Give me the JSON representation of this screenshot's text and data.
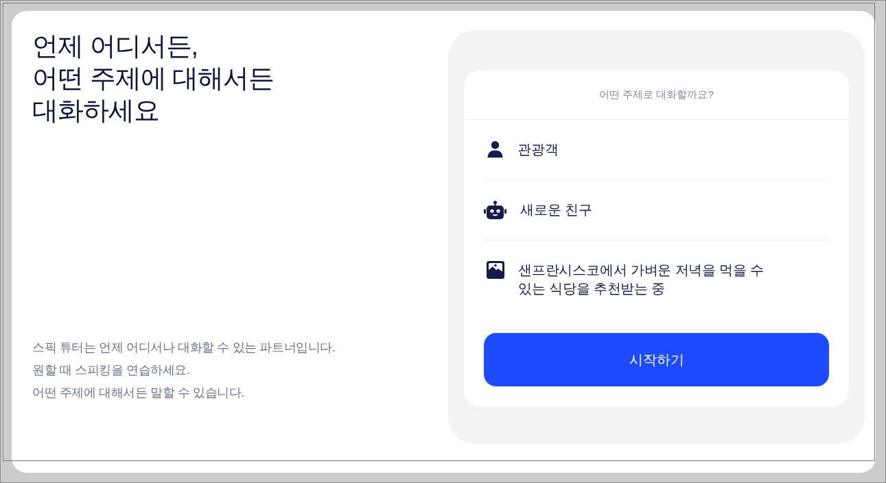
{
  "hero": {
    "headline": "언제 어디서든,\n어떤 주제에 대해서든\n대화하세요",
    "description": "스픽 튜터는 언제 어디서나 대화할 수 있는 파트너입니다.\n원할 때 스피킹을 연습하세요.\n어떤 주제에 대해서든 말할 수 있습니다."
  },
  "topic_card": {
    "prompt": "어떤 주제로 대화할까요?",
    "options": [
      {
        "kind": "person",
        "label": "관광객"
      },
      {
        "kind": "robot",
        "label": "새로운 친구"
      },
      {
        "kind": "image",
        "label": "샌프란시스코에서 가벼운 저녁을 먹을 수 있는 식당을 추천받는 중"
      }
    ],
    "start_button": "시작하기"
  }
}
